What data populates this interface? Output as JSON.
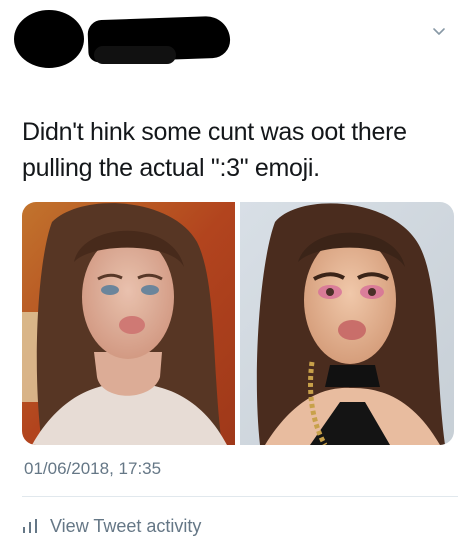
{
  "header": {
    "avatar_redacted": true,
    "name_redacted": true,
    "menu_icon": "chevron-down-icon"
  },
  "tweet": {
    "text_line_1": "Didn't hink some cunt was oot there",
    "text_line_2": "pulling the actual \":3\" emoji.",
    "timestamp": "01/06/2018, 17:35",
    "activity_label": "View Tweet activity"
  },
  "media": {
    "left_photo": "selfie-left",
    "right_photo": "selfie-right"
  },
  "colors": {
    "text_primary": "#14171a",
    "text_secondary": "#657786",
    "divider": "#e1e8ed"
  }
}
